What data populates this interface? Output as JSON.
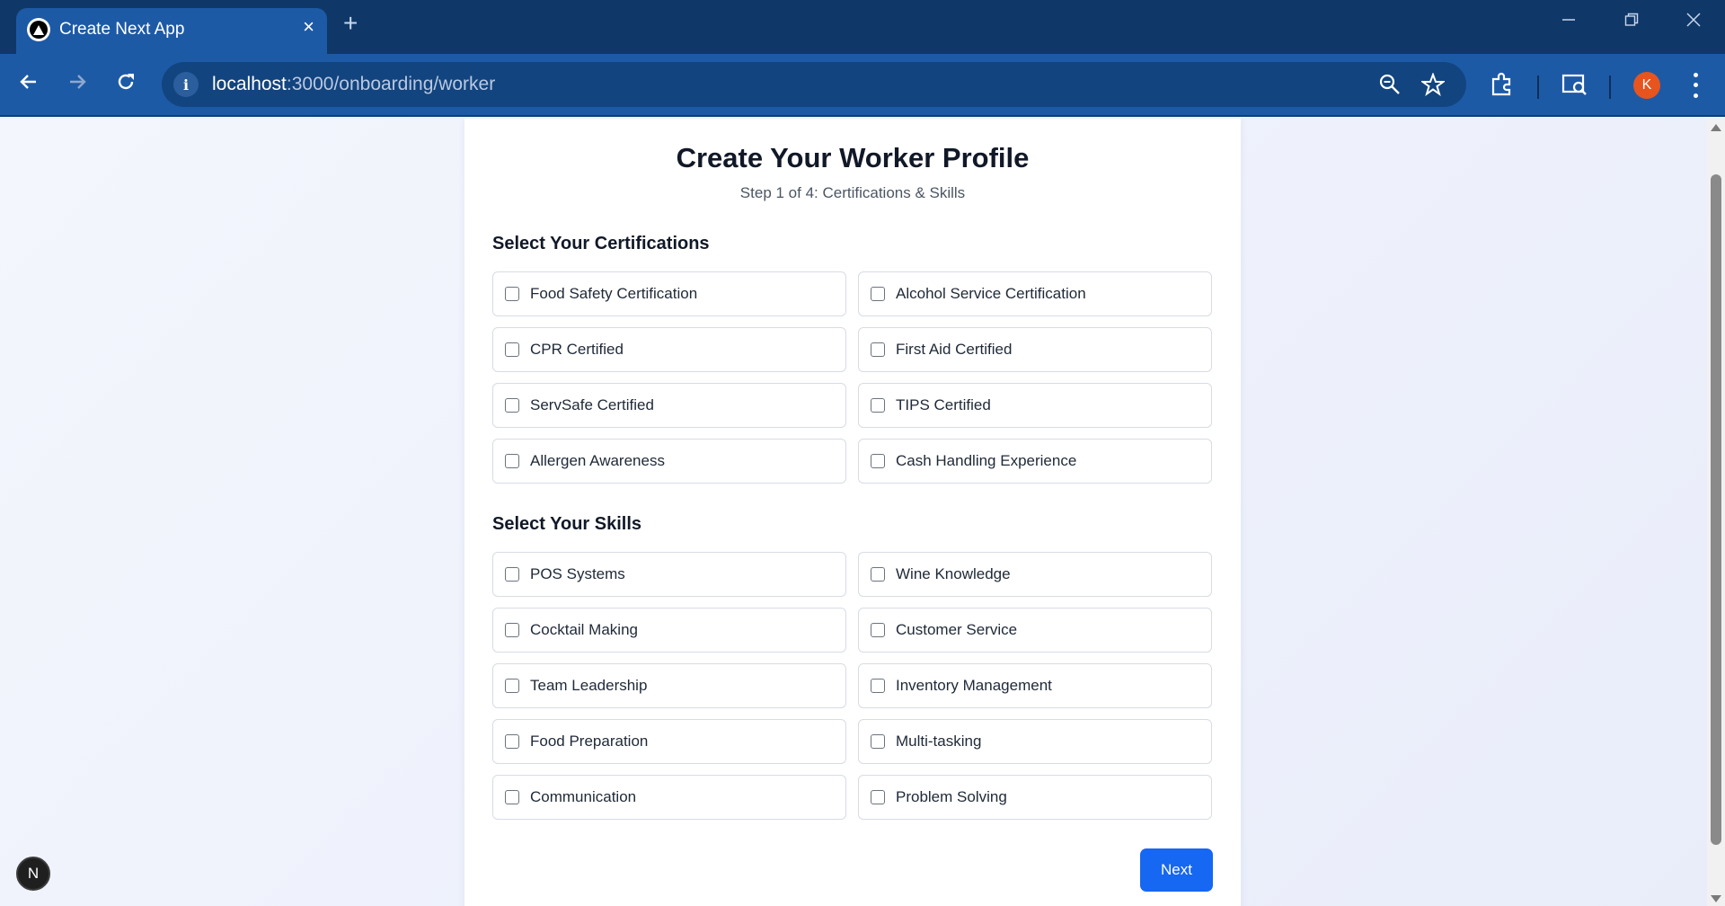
{
  "browser": {
    "tab_title": "Create Next App",
    "tab_close": "×",
    "new_tab": "+",
    "url_host": "localhost",
    "url_path": ":3000/onboarding/worker",
    "profile_initial": "K"
  },
  "page": {
    "title": "Create Your Worker Profile",
    "subtitle": "Step 1 of 4: Certifications & Skills",
    "certifications_heading": "Select Your Certifications",
    "certifications": [
      "Food Safety Certification",
      "Alcohol Service Certification",
      "CPR Certified",
      "First Aid Certified",
      "ServSafe Certified",
      "TIPS Certified",
      "Allergen Awareness",
      "Cash Handling Experience"
    ],
    "skills_heading": "Select Your Skills",
    "skills": [
      "POS Systems",
      "Wine Knowledge",
      "Cocktail Making",
      "Customer Service",
      "Team Leadership",
      "Inventory Management",
      "Food Preparation",
      "Multi-tasking",
      "Communication",
      "Problem Solving"
    ],
    "next_label": "Next",
    "dev_badge": "N"
  },
  "colors": {
    "tabbar": "#0f3868",
    "toolbar": "#1d5aa6",
    "primary_button": "#1667f2"
  }
}
